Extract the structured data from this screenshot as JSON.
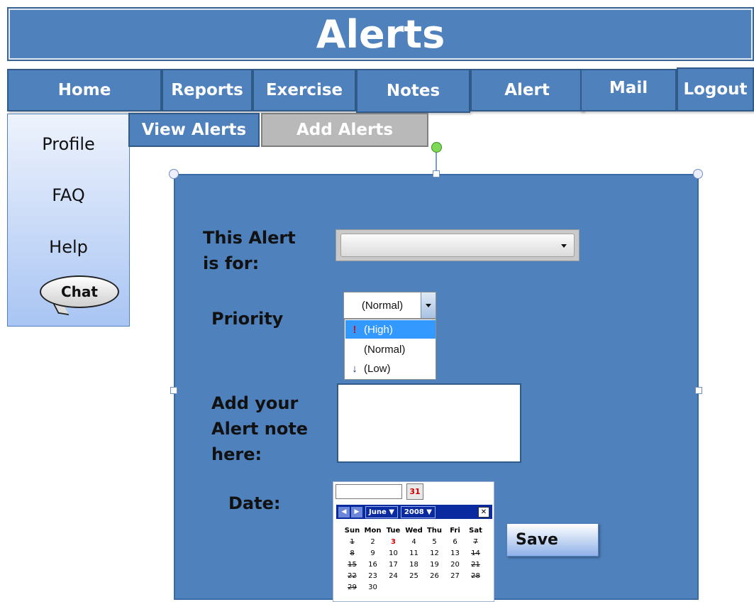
{
  "header": {
    "title": "Alerts"
  },
  "nav": {
    "tabs": [
      {
        "label": "Home"
      },
      {
        "label": "Reports"
      },
      {
        "label": "Exercise"
      },
      {
        "label": "Notes"
      },
      {
        "label": "Alert"
      },
      {
        "label": "Mail"
      },
      {
        "label": "Logout"
      }
    ]
  },
  "sidebar": {
    "items": [
      {
        "label": "Profile"
      },
      {
        "label": "FAQ"
      },
      {
        "label": "Help"
      }
    ],
    "chat_label": "Chat"
  },
  "subtabs": {
    "view_alerts": "View Alerts",
    "add_alerts": "Add Alerts"
  },
  "form": {
    "alert_for_line1": "This Alert",
    "alert_for_line2": "is for:",
    "alert_for_value": "",
    "priority_label": "Priority",
    "priority_value": "(Normal)",
    "priority_options": [
      {
        "label": "(High)",
        "icon": "exclamation-icon",
        "selected": true
      },
      {
        "label": "(Normal)",
        "icon": "",
        "selected": false
      },
      {
        "label": "(Low)",
        "icon": "down-arrow-icon",
        "selected": false
      }
    ],
    "note_line1": "Add your",
    "note_line2": "Alert note",
    "note_line3": "here:",
    "note_value": "",
    "date_label": "Date:",
    "date_value": "",
    "save_label": "Save"
  },
  "calendar": {
    "month": "June",
    "year": "2008",
    "days_of_week": [
      "Sun",
      "Mon",
      "Tue",
      "Wed",
      "Thu",
      "Fri",
      "Sat"
    ],
    "weeks": [
      [
        "1",
        "2",
        "3",
        "4",
        "5",
        "6",
        "7"
      ],
      [
        "8",
        "9",
        "10",
        "11",
        "12",
        "13",
        "14"
      ],
      [
        "15",
        "16",
        "17",
        "18",
        "19",
        "20",
        "21"
      ],
      [
        "22",
        "23",
        "24",
        "25",
        "26",
        "27",
        "28"
      ],
      [
        "29",
        "30",
        "",
        "",
        "",
        "",
        ""
      ]
    ],
    "highlighted_day": "3",
    "highlight_color": "#e00000"
  },
  "colors": {
    "accent": "#4f81bd",
    "selected_option": "#3399ff"
  }
}
